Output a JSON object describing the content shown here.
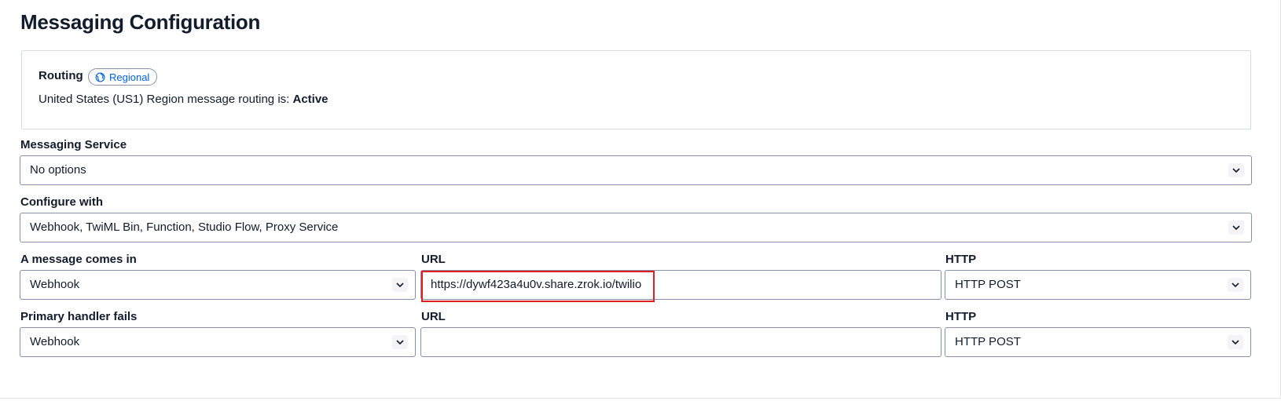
{
  "page": {
    "title": "Messaging Configuration"
  },
  "routing": {
    "title": "Routing",
    "badge_label": "Regional",
    "badge_icon": "globe-icon",
    "status_prefix": "United States (US1) Region message routing is: ",
    "status_value": "Active"
  },
  "messaging_service": {
    "label": "Messaging Service",
    "selected": "No options"
  },
  "configure_with": {
    "label": "Configure with",
    "selected": "Webhook, TwiML Bin, Function, Studio Flow, Proxy Service"
  },
  "message_comes_in": {
    "label": "A message comes in",
    "type_selected": "Webhook",
    "url_label": "URL",
    "url_value": "https://dywf423a4u0v.share.zrok.io/twilio",
    "http_label": "HTTP",
    "http_selected": "HTTP POST"
  },
  "primary_handler_fails": {
    "label": "Primary handler fails",
    "type_selected": "Webhook",
    "url_label": "URL",
    "url_value": "",
    "http_label": "HTTP",
    "http_selected": "HTTP POST"
  },
  "colors": {
    "text": "#121c2d",
    "link_blue": "#0263e0",
    "border": "#8891aa",
    "highlight": "#e02020"
  }
}
